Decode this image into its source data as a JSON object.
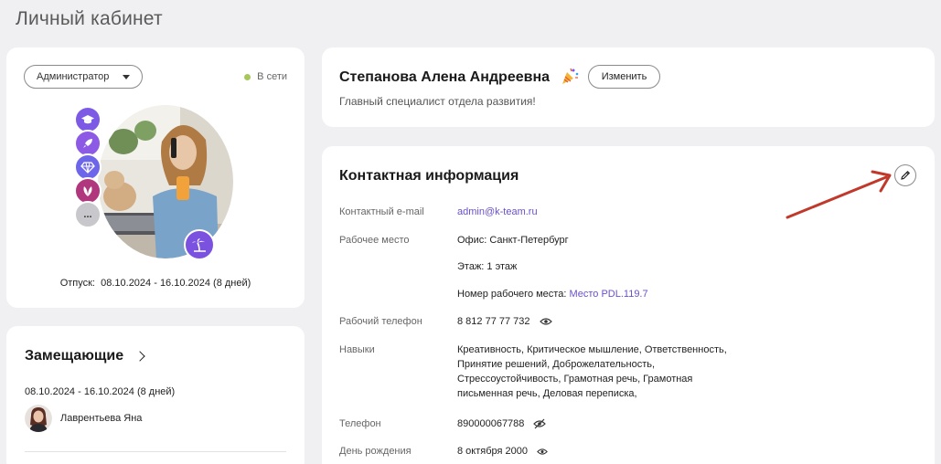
{
  "page": {
    "title": "Личный кабинет"
  },
  "profile": {
    "role": "Администратор",
    "status": "В сети",
    "status_color": "#a6c75a",
    "achievements": [
      {
        "icon": "graduation-cap-icon",
        "color": "#7c5ae6"
      },
      {
        "icon": "rocket-icon",
        "color": "#8d5ae6"
      },
      {
        "icon": "diamond-icon",
        "color": "#6d66ea"
      },
      {
        "icon": "leaf-icon",
        "color": "#b0377d"
      },
      {
        "icon": "more-icon",
        "color": "#c8c8cc",
        "label": "..."
      }
    ],
    "vacation_label": "Отпуск:",
    "vacation_period": "08.10.2024 - 16.10.2024 (8 дней)"
  },
  "substitutes": {
    "title": "Замещающие",
    "period": "08.10.2024 - 16.10.2024 (8 дней)",
    "person": "Лаврентьева Яна"
  },
  "employee": {
    "full_name": "Степанова Алена Андреевна",
    "edit_label": "Изменить",
    "position": "Главный специалист отдела развития!"
  },
  "contact": {
    "title": "Контактная информация",
    "email_label": "Контактный e-mail",
    "email": "admin@k-team.ru",
    "workplace_label": "Рабочее место",
    "office": "Офис: Санкт-Петербург",
    "floor": "Этаж: 1 этаж",
    "desk_label": "Номер рабочего места:",
    "desk": "Место PDL.119.7",
    "work_phone_label": "Рабочий телефон",
    "work_phone": "8 812 77 77 732",
    "skills_label": "Навыки",
    "skills": "Креативность, Критическое мышление, Ответственность, Принятие решений, Доброжелательность, Стрессоустойчивость, Грамотная речь, Грамотная письменная речь, Деловая переписка,",
    "phone_label": "Телефон",
    "phone": "890000067788",
    "birthday_label": "День рождения",
    "birthday": "8 октября 2000"
  },
  "colors": {
    "accent": "#6a4fd0",
    "annotation_arrow": "#c0392b"
  }
}
